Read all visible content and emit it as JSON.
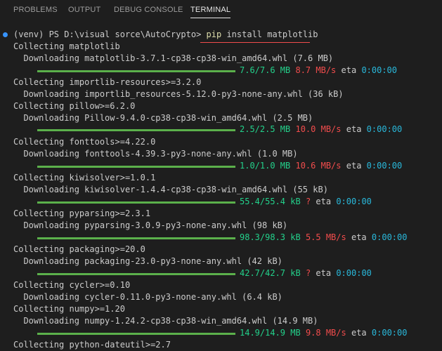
{
  "tabs": [
    {
      "label": "PROBLEMS"
    },
    {
      "label": "OUTPUT"
    },
    {
      "label": "DEBUG CONSOLE"
    },
    {
      "label": "TERMINAL"
    }
  ],
  "prompt": {
    "text": "(venv) PS D:\\visual sorce\\AutoCrypto> ",
    "cmd_pip": "pip",
    "cmd_rest": " install matplotlib"
  },
  "lines": {
    "l1": "Collecting matplotlib",
    "l2": "  Downloading matplotlib-3.7.1-cp38-cp38-win_amd64.whl (7.6 MB)",
    "l3": "Collecting importlib-resources>=3.2.0",
    "l4": "  Downloading importlib_resources-5.12.0-py3-none-any.whl (36 kB)",
    "l5": "Collecting pillow>=6.2.0",
    "l6": "  Downloading Pillow-9.4.0-cp38-cp38-win_amd64.whl (2.5 MB)",
    "l7": "Collecting fonttools>=4.22.0",
    "l8": "  Downloading fonttools-4.39.3-py3-none-any.whl (1.0 MB)",
    "l9": "Collecting kiwisolver>=1.0.1",
    "l10": "  Downloading kiwisolver-1.4.4-cp38-cp38-win_amd64.whl (55 kB)",
    "l11": "Collecting pyparsing>=2.3.1",
    "l12": "  Downloading pyparsing-3.0.9-py3-none-any.whl (98 kB)",
    "l13": "Collecting packaging>=20.0",
    "l14": "  Downloading packaging-23.0-py3-none-any.whl (42 kB)",
    "l15": "Collecting cycler>=0.10",
    "l16": "  Downloading cycler-0.11.0-py3-none-any.whl (6.4 kB)",
    "l17": "Collecting numpy>=1.20",
    "l18": "  Downloading numpy-1.24.2-cp38-cp38-win_amd64.whl (14.9 MB)",
    "l19": "Collecting python-dateutil>=2.7"
  },
  "progress": [
    {
      "size": "7.6/7.6 MB",
      "speed": "8.7 MB/s",
      "eta_label": "eta",
      "eta": "0:00:00",
      "fraction": 1.0
    },
    {
      "size": "2.5/2.5 MB",
      "speed": "10.0 MB/s",
      "eta_label": "eta",
      "eta": "0:00:00",
      "fraction": 1.0
    },
    {
      "size": "1.0/1.0 MB",
      "speed": "10.6 MB/s",
      "eta_label": "eta",
      "eta": "0:00:00",
      "fraction": 1.0
    },
    {
      "size": "55.4/55.4 kB",
      "speed": "?",
      "eta_label": "eta",
      "eta": "0:00:00",
      "fraction": 1.0
    },
    {
      "size": "98.3/98.3 kB",
      "speed": "5.5 MB/s",
      "eta_label": "eta",
      "eta": "0:00:00",
      "fraction": 1.0
    },
    {
      "size": "42.7/42.7 kB",
      "speed": "?",
      "eta_label": "eta",
      "eta": "0:00:00",
      "fraction": 1.0
    },
    {
      "size": "14.9/14.9 MB",
      "speed": "9.8 MB/s",
      "eta_label": "eta",
      "eta": "0:00:00",
      "fraction": 1.0
    }
  ],
  "colors": {
    "background": "#1e1e1e",
    "progress_bar": "#5bb04b",
    "size_text": "#23d18b",
    "speed_text": "#f14c4c",
    "eta_text": "#29b8db",
    "prompt_dot": "#3794ff"
  },
  "icons": {
    "prompt_status": "circle-dot-icon"
  }
}
